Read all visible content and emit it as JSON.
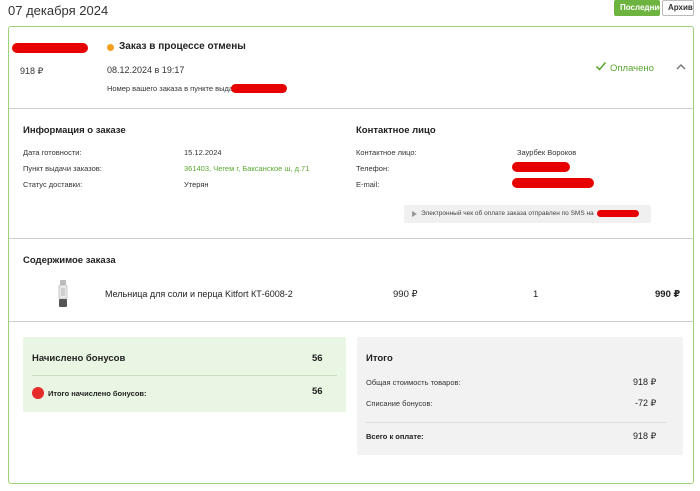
{
  "header": {
    "date": "07 декабря 2024",
    "tab_recent": "Последние",
    "tab_archive": "Архив",
    "accent_color": "#6db33f"
  },
  "order": {
    "price": "918 ₽",
    "status_title": "Заказ в процессе отмены",
    "status_color": "#f2a01e",
    "datetime": "08.12.2024 в 19:17",
    "pickup_label": "Номер вашего заказа в пункте выдачи:",
    "paid_label": "Оплачено",
    "icons": [
      "check-icon",
      "chevron-up-icon"
    ]
  },
  "info": {
    "title": "Информация о заказе",
    "ready_label": "Дата готовности:",
    "ready_value": "15.12.2024",
    "point_label": "Пункт выдачи заказов:",
    "point_value": "361403, Чегем г, Баксанское ш, д.71",
    "delivery_label": "Статус доставки:",
    "delivery_value": "Утерян"
  },
  "contact": {
    "title": "Контактное лицо",
    "person_label": "Контактное лицо:",
    "person_value": "Заурбек Вороков",
    "phone_label": "Телефон:",
    "email_label": "E-mail:",
    "sms_text": "Электронный чек об оплате заказа отправлен по SMS на"
  },
  "contents": {
    "title": "Содержимое заказа",
    "items": [
      {
        "name": "Мельница для соли и перца Kitfort КТ-6008-2",
        "price": "990 ₽",
        "qty": "1",
        "sum": "990 ₽"
      }
    ]
  },
  "bonus": {
    "title": "Начислено бонусов",
    "value": "56",
    "sub_label": "Итого начислено бонусов:",
    "sub_value": "56"
  },
  "totals": {
    "title": "Итого",
    "goods_label": "Общая стоимость товаров:",
    "goods_value": "918 ₽",
    "bonus_label": "Списание бонусов:",
    "bonus_value": "-72 ₽",
    "pay_label": "Всего к оплате:",
    "pay_value": "918 ₽"
  }
}
